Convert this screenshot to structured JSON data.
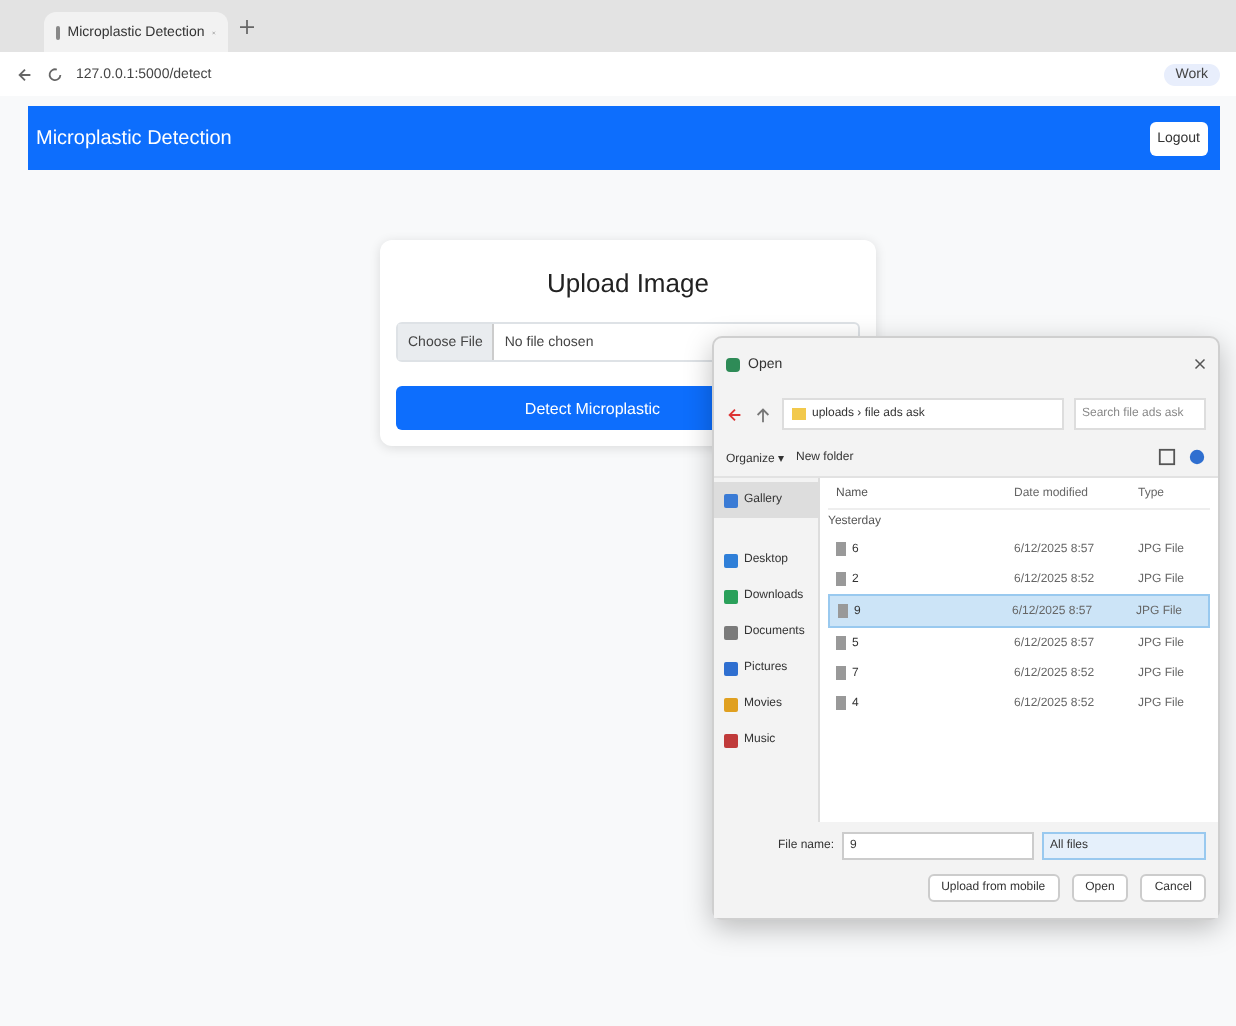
{
  "browser": {
    "tab_title": "Microplastic Detection",
    "address": "127.0.0.1:5000/detect",
    "profile": "Work"
  },
  "navbar": {
    "brand": "Microplastic Detection",
    "button": "Logout"
  },
  "card": {
    "title": "Upload Image",
    "file_button": "Choose File",
    "file_status": "No file chosen",
    "submit": "Detect Microplastic"
  },
  "dialog": {
    "title": "Open",
    "path": "uploads › file ads ask",
    "search_placeholder": "Search file ads ask",
    "organize": "Organize ▾",
    "new_folder": "New folder",
    "sidebar": [
      {
        "label": "Gallery",
        "selected": true,
        "color": "#3a7bd5"
      },
      {
        "label": "Desktop",
        "selected": false,
        "color": "#2f7fd8"
      },
      {
        "label": "Downloads",
        "selected": false,
        "color": "#2aa05a"
      },
      {
        "label": "Documents",
        "selected": false,
        "color": "#7a7a7a"
      },
      {
        "label": "Pictures",
        "selected": false,
        "color": "#2f6fd0"
      },
      {
        "label": "Movies",
        "selected": false,
        "color": "#e0a020"
      },
      {
        "label": "Music",
        "selected": false,
        "color": "#c03a3a"
      }
    ],
    "columns": [
      "Name",
      "Date modified",
      "Type"
    ],
    "group": "Yesterday",
    "rows": [
      {
        "name": "6",
        "date": "6/12/2025 8:57",
        "type": "JPG File",
        "selected": false
      },
      {
        "name": "2",
        "date": "6/12/2025 8:52",
        "type": "JPG File",
        "selected": false
      },
      {
        "name": "9",
        "date": "6/12/2025 8:57",
        "type": "JPG File",
        "selected": true
      },
      {
        "name": "5",
        "date": "6/12/2025 8:57",
        "type": "JPG File",
        "selected": false
      },
      {
        "name": "7",
        "date": "6/12/2025 8:52",
        "type": "JPG File",
        "selected": false
      },
      {
        "name": "4",
        "date": "6/12/2025 8:52",
        "type": "JPG File",
        "selected": false
      }
    ],
    "file_name_label": "File name:",
    "file_name": "9",
    "filter": "All files",
    "mobile": "Upload from mobile",
    "open": "Open",
    "cancel": "Cancel"
  }
}
